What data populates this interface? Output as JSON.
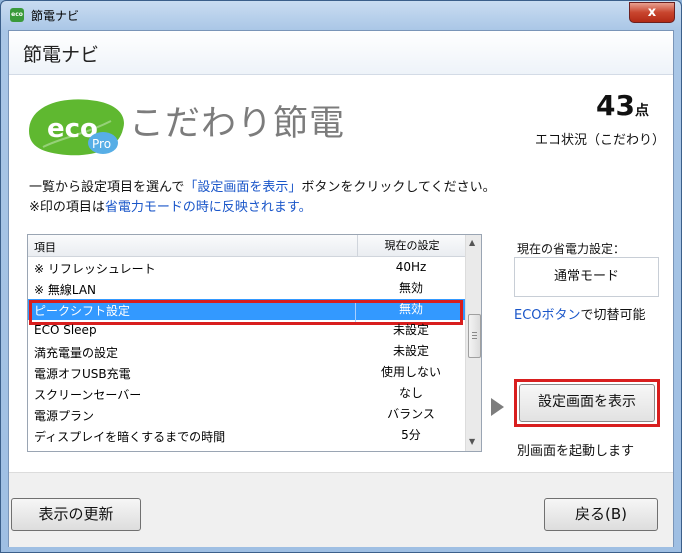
{
  "window": {
    "app_icon_text": "eco",
    "title": "節電ナビ",
    "close_glyph": "x"
  },
  "header": {
    "title": "節電ナビ"
  },
  "logo": {
    "eco_text": "eco",
    "pro_text": "Pro",
    "mode_title": "こだわり節電"
  },
  "score": {
    "value": "43",
    "unit": "点",
    "label": "エコ状況（こだわり）"
  },
  "instructions": {
    "line1_prefix": "一覧から設定項目を選んで",
    "line1_link": "「設定画面を表示」",
    "line1_suffix": "ボタンをクリックしてください。",
    "line2_prefix": "※印の項目は",
    "line2_link": "省電力モードの時に反映されます。"
  },
  "list": {
    "col_item": "項目",
    "col_current": "現在の設定",
    "rows": [
      {
        "item": "※ リフレッシュレート",
        "value": "40Hz"
      },
      {
        "item": "※ 無線LAN",
        "value": "無効"
      },
      {
        "item": "ピークシフト設定",
        "value": "無効"
      },
      {
        "item": "ECO Sleep",
        "value": "未設定"
      },
      {
        "item": "満充電量の設定",
        "value": "未設定"
      },
      {
        "item": "電源オフUSB充電",
        "value": "使用しない"
      },
      {
        "item": "スクリーンセーバー",
        "value": "なし"
      },
      {
        "item": "電源プラン",
        "value": "バランス"
      },
      {
        "item": "ディスプレイを暗くするまでの時間",
        "value": "5分"
      }
    ],
    "selected_index": 2
  },
  "power_mode": {
    "label": "現在の省電力設定：",
    "value": "通常モード",
    "note_link": "ECOボタン",
    "note_suffix": "で切替可能"
  },
  "show_settings_button": {
    "label": "設定画面を表示",
    "note": "別画面を起動します"
  },
  "footer": {
    "refresh_label": "表示の更新",
    "back_label": "戻る(B)"
  },
  "colors": {
    "selection": "#3399ff",
    "highlight_outline": "#d81e1e",
    "link": "#1a56c9",
    "eco_green": "#5fb830",
    "pro_blue": "#57aee6"
  },
  "icons": {
    "scroll_up": "triangle-up-icon",
    "scroll_down": "triangle-down-icon",
    "pointer_arrow": "play-arrow-icon"
  }
}
